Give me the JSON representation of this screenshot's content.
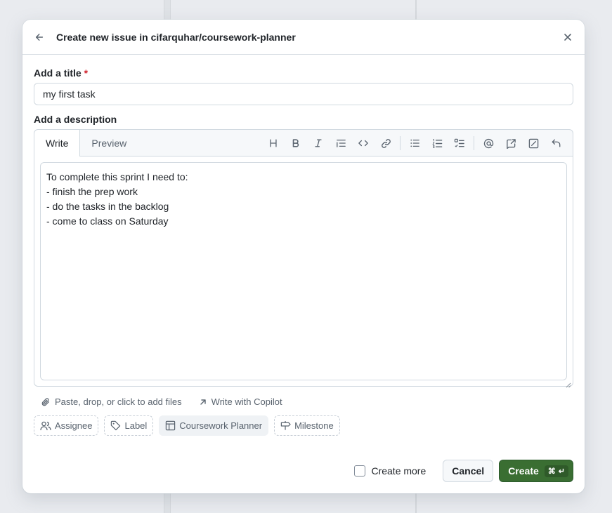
{
  "dialog": {
    "title": "Create new issue in cifarquhar/coursework-planner"
  },
  "title_field": {
    "label": "Add a title",
    "required_mark": "*",
    "value": "my first task"
  },
  "description": {
    "label": "Add a description",
    "tabs": [
      {
        "label": "Write",
        "active": true
      },
      {
        "label": "Preview",
        "active": false
      }
    ],
    "toolbar": [
      "heading-icon",
      "bold-icon",
      "italic-icon",
      "quote-icon",
      "code-icon",
      "link-icon",
      "unordered-list-icon",
      "ordered-list-icon",
      "task-list-icon",
      "mention-icon",
      "reference-icon",
      "saved-reply-icon",
      "undo-icon"
    ],
    "text": "To complete this sprint I need to:\n- finish the prep work\n- do the tasks in the backlog\n- come to class on Saturday"
  },
  "attachments": {
    "files_label": "Paste, drop, or click to add files",
    "copilot_label": "Write with Copilot"
  },
  "metadata": {
    "assignee": "Assignee",
    "label": "Label",
    "project": "Coursework Planner",
    "milestone": "Milestone"
  },
  "footer": {
    "create_more": "Create more",
    "cancel": "Cancel",
    "create": "Create",
    "shortcut_cmd": "⌘",
    "shortcut_enter": "↵"
  },
  "colors": {
    "primary": "#3a6e32",
    "required": "#d1242f"
  }
}
